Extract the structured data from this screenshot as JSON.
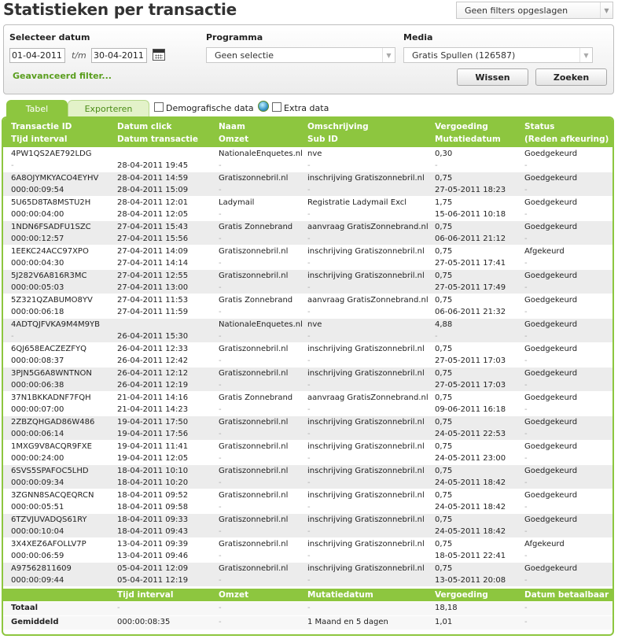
{
  "page": {
    "title": "Statistieken per transactie",
    "saved_filters": "Geen filters opgeslagen"
  },
  "filters": {
    "date_label": "Selecteer datum",
    "date_from": "01-04-2011",
    "date_sep": "t/m",
    "date_to": "30-04-2011",
    "program_label": "Programma",
    "program_value": "Geen selectie",
    "media_label": "Media",
    "media_value": "Gratis Spullen (126587)",
    "advanced": "Geavanceerd filter...",
    "clear_button": "Wissen",
    "search_button": "Zoeken"
  },
  "tabs": {
    "table": "Tabel",
    "export": "Exporteren",
    "demographic": "Demografische data",
    "extra": "Extra data"
  },
  "table": {
    "headers": [
      [
        "Transactie ID",
        "Tijd interval"
      ],
      [
        "Datum click",
        "Datum transactie"
      ],
      [
        "Naam",
        "Omzet"
      ],
      [
        "Omschrijving",
        "Sub ID"
      ],
      [
        "Vergoeding",
        "Mutatiedatum"
      ],
      [
        "Status",
        "(Reden afkeuring)"
      ]
    ],
    "rows": [
      {
        "id": "4PW1QS2AE792LDG",
        "interval": "-",
        "click": "",
        "trans": "28-04-2011 19:45",
        "name": "NationaleEnquetes.nl",
        "omzet": "-",
        "desc": "nve",
        "sub": "-",
        "fee": "0,30",
        "mut": "-",
        "status": "Goedgekeurd",
        "reason": "-"
      },
      {
        "id": "6A8OJYMKYACO4EYHV",
        "interval": "000:00:09:54",
        "click": "28-04-2011 14:59",
        "trans": "28-04-2011 15:09",
        "name": "Gratiszonnebril.nl",
        "omzet": "-",
        "desc": "inschrijving Gratiszonnebril.nl",
        "sub": "-",
        "fee": "0,75",
        "mut": "27-05-2011 18:23",
        "status": "Goedgekeurd",
        "reason": "-"
      },
      {
        "id": "5U65D8TA8MSTU2H",
        "interval": "000:00:04:00",
        "click": "28-04-2011 12:01",
        "trans": "28-04-2011 12:05",
        "name": "Ladymail",
        "omzet": "-",
        "desc": "Registratie Ladymail Excl",
        "sub": "-",
        "fee": "1,75",
        "mut": "15-06-2011 10:18",
        "status": "Goedgekeurd",
        "reason": "-"
      },
      {
        "id": "1NDN6FSADFU1SZC",
        "interval": "000:00:12:57",
        "click": "27-04-2011 15:43",
        "trans": "27-04-2011 15:56",
        "name": "Gratis Zonnebrand",
        "omzet": "-",
        "desc": "aanvraag GratisZonnebrand.nl",
        "sub": "-",
        "fee": "0,75",
        "mut": "06-06-2011 21:12",
        "status": "Goedgekeurd",
        "reason": "-"
      },
      {
        "id": "1EEKC24ACC97XPO",
        "interval": "000:00:04:30",
        "click": "27-04-2011 14:09",
        "trans": "27-04-2011 14:14",
        "name": "Gratiszonnebril.nl",
        "omzet": "-",
        "desc": "inschrijving Gratiszonnebril.nl",
        "sub": "-",
        "fee": "0,75",
        "mut": "27-05-2011 17:41",
        "status": "Afgekeurd",
        "reason": "-"
      },
      {
        "id": "5J282V6A816R3MC",
        "interval": "000:00:05:03",
        "click": "27-04-2011 12:55",
        "trans": "27-04-2011 13:00",
        "name": "Gratiszonnebril.nl",
        "omzet": "-",
        "desc": "inschrijving Gratiszonnebril.nl",
        "sub": "-",
        "fee": "0,75",
        "mut": "27-05-2011 17:49",
        "status": "Goedgekeurd",
        "reason": "-"
      },
      {
        "id": "5Z321QZABUMO8YV",
        "interval": "000:00:06:18",
        "click": "27-04-2011 11:53",
        "trans": "27-04-2011 11:59",
        "name": "Gratis Zonnebrand",
        "omzet": "-",
        "desc": "aanvraag GratisZonnebrand.nl",
        "sub": "-",
        "fee": "0,75",
        "mut": "06-06-2011 21:32",
        "status": "Goedgekeurd",
        "reason": "-"
      },
      {
        "id": "4ADTQJFVKA9M4M9YB",
        "interval": "-",
        "click": "",
        "trans": "26-04-2011 15:30",
        "name": "NationaleEnquetes.nl",
        "omzet": "-",
        "desc": "nve",
        "sub": "-",
        "fee": "4,88",
        "mut": "-",
        "status": "Goedgekeurd",
        "reason": "-"
      },
      {
        "id": "6QJ658EACZEZFYQ",
        "interval": "000:00:08:37",
        "click": "26-04-2011 12:33",
        "trans": "26-04-2011 12:42",
        "name": "Gratiszonnebril.nl",
        "omzet": "-",
        "desc": "inschrijving Gratiszonnebril.nl",
        "sub": "-",
        "fee": "0,75",
        "mut": "27-05-2011 17:03",
        "status": "Goedgekeurd",
        "reason": "-"
      },
      {
        "id": "3PJN5G6A8WNTNON",
        "interval": "000:00:06:38",
        "click": "26-04-2011 12:12",
        "trans": "26-04-2011 12:19",
        "name": "Gratiszonnebril.nl",
        "omzet": "-",
        "desc": "inschrijving Gratiszonnebril.nl",
        "sub": "-",
        "fee": "0,75",
        "mut": "27-05-2011 17:03",
        "status": "Goedgekeurd",
        "reason": "-"
      },
      {
        "id": "37N1BKKADNF7FQH",
        "interval": "000:00:07:00",
        "click": "21-04-2011 14:16",
        "trans": "21-04-2011 14:23",
        "name": "Gratis Zonnebrand",
        "omzet": "-",
        "desc": "aanvraag GratisZonnebrand.nl",
        "sub": "-",
        "fee": "0,75",
        "mut": "09-06-2011 16:18",
        "status": "Goedgekeurd",
        "reason": "-"
      },
      {
        "id": "2ZBZQHGAD86W486",
        "interval": "000:00:06:14",
        "click": "19-04-2011 17:50",
        "trans": "19-04-2011 17:56",
        "name": "Gratiszonnebril.nl",
        "omzet": "-",
        "desc": "inschrijving Gratiszonnebril.nl",
        "sub": "-",
        "fee": "0,75",
        "mut": "24-05-2011 22:53",
        "status": "Goedgekeurd",
        "reason": "-"
      },
      {
        "id": "1MXG9V8ACQR9FXE",
        "interval": "000:00:24:00",
        "click": "19-04-2011 11:41",
        "trans": "19-04-2011 12:05",
        "name": "Gratiszonnebril.nl",
        "omzet": "-",
        "desc": "inschrijving Gratiszonnebril.nl",
        "sub": "-",
        "fee": "0,75",
        "mut": "24-05-2011 23:00",
        "status": "Goedgekeurd",
        "reason": "-"
      },
      {
        "id": "6SVS5SPAFOC5LHD",
        "interval": "000:00:09:34",
        "click": "18-04-2011 10:10",
        "trans": "18-04-2011 10:20",
        "name": "Gratiszonnebril.nl",
        "omzet": "-",
        "desc": "inschrijving Gratiszonnebril.nl",
        "sub": "-",
        "fee": "0,75",
        "mut": "24-05-2011 18:42",
        "status": "Goedgekeurd",
        "reason": "-"
      },
      {
        "id": "3ZGNN8SACQEQRCN",
        "interval": "000:00:05:51",
        "click": "18-04-2011 09:52",
        "trans": "18-04-2011 09:58",
        "name": "Gratiszonnebril.nl",
        "omzet": "-",
        "desc": "inschrijving Gratiszonnebril.nl",
        "sub": "-",
        "fee": "0,75",
        "mut": "24-05-2011 18:42",
        "status": "Goedgekeurd",
        "reason": "-"
      },
      {
        "id": "6TZVJUVADQS61RY",
        "interval": "000:00:10:04",
        "click": "18-04-2011 09:33",
        "trans": "18-04-2011 09:43",
        "name": "Gratiszonnebril.nl",
        "omzet": "-",
        "desc": "inschrijving Gratiszonnebril.nl",
        "sub": "-",
        "fee": "0,75",
        "mut": "24-05-2011 18:42",
        "status": "Goedgekeurd",
        "reason": "-"
      },
      {
        "id": "3X4XEZ6AFOLLV7P",
        "interval": "000:00:06:59",
        "click": "13-04-2011 09:39",
        "trans": "13-04-2011 09:46",
        "name": "Gratiszonnebril.nl",
        "omzet": "-",
        "desc": "inschrijving Gratiszonnebril.nl",
        "sub": "-",
        "fee": "0,75",
        "mut": "18-05-2011 22:41",
        "status": "Afgekeurd",
        "reason": "-"
      },
      {
        "id": "A97562811609",
        "interval": "000:00:09:44",
        "click": "05-04-2011 12:09",
        "trans": "05-04-2011 12:19",
        "name": "Gratiszonnebril.nl",
        "omzet": "-",
        "desc": "inschrijving Gratiszonnebril.nl",
        "sub": "-",
        "fee": "0,75",
        "mut": "13-05-2011 20:08",
        "status": "Goedgekeurd",
        "reason": "-"
      }
    ],
    "footer_headers": [
      "",
      "Tijd interval",
      "Omzet",
      "Mutatiedatum",
      "Vergoeding",
      "Datum betaalbaar"
    ],
    "totals": {
      "label": "Totaal",
      "interval": "-",
      "omzet": "-",
      "mut": "-",
      "fee": "18,18",
      "pay": "-"
    },
    "average": {
      "label": "Gemiddeld",
      "interval": "000:00:08:35",
      "omzet": "-",
      "mut": "1 Maand en 5 dagen",
      "fee": "1,01",
      "pay": "-"
    }
  }
}
